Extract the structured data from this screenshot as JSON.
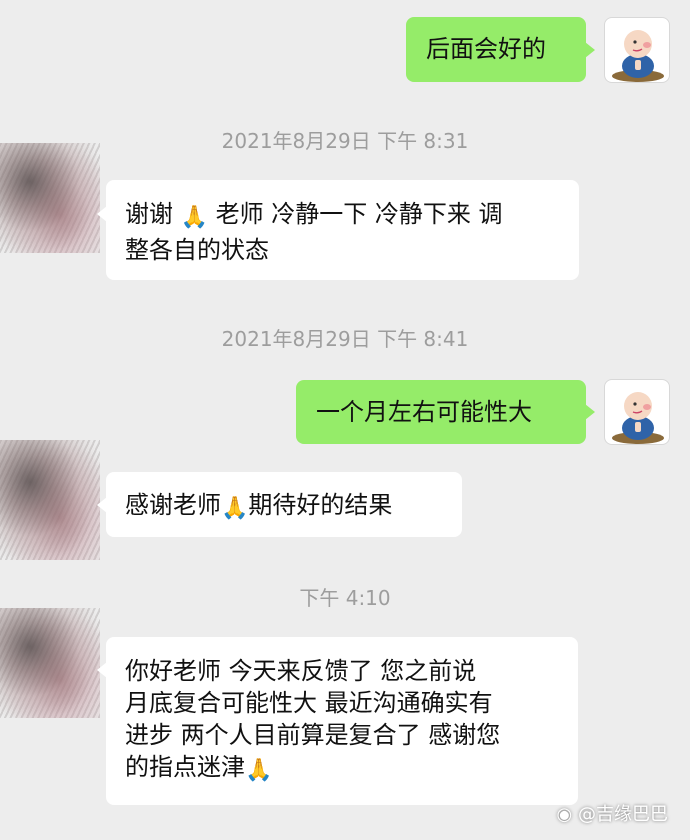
{
  "messages": [
    {
      "id": "m1",
      "side": "right",
      "text": "后面会好的"
    },
    {
      "id": "ts1",
      "type": "timestamp",
      "text": "2021年8月29日 下午 8:31"
    },
    {
      "id": "m2",
      "side": "left",
      "lines": [
        "谢谢 🙏 老师 冷静一下 冷静下来 调",
        "整各自的状态"
      ]
    },
    {
      "id": "ts2",
      "type": "timestamp",
      "text": "2021年8月29日 下午 8:41"
    },
    {
      "id": "m3",
      "side": "right",
      "text": "一个月左右可能性大"
    },
    {
      "id": "m4",
      "side": "left",
      "text": "感谢老师🙏期待好的结果"
    },
    {
      "id": "ts3",
      "type": "timestamp",
      "text": "下午 4:10"
    },
    {
      "id": "m5",
      "side": "left",
      "lines": [
        "你好老师 今天来反馈了 您之前说",
        "月底复合可能性大 最近沟通确实有",
        "进步 两个人目前算是复合了 感谢您",
        "的指点迷津🙏"
      ]
    }
  ],
  "watermark": "@吉缘巴巴",
  "colors": {
    "background": "#ededed",
    "self_bubble": "#95ec69",
    "other_bubble": "#ffffff",
    "timestamp": "#9d9d9d"
  },
  "icons": {
    "self_avatar": "cartoon-monk-avatar",
    "other_avatar": "blurred-avatar",
    "emoji": "folded-hands-emoji"
  }
}
